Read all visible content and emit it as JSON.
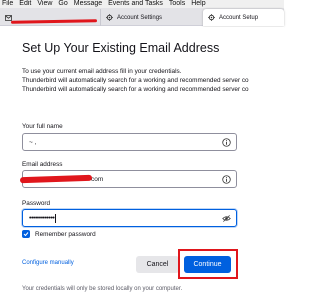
{
  "menubar": {
    "items": [
      "File",
      "Edit",
      "View",
      "Go",
      "Message",
      "Events and Tasks",
      "Tools",
      "Help"
    ]
  },
  "tabs": [
    {
      "label": "",
      "icon": "mail-icon"
    },
    {
      "label": "Account Settings",
      "icon": "gear-icon"
    },
    {
      "label": "Account Setup",
      "icon": "gear-icon"
    }
  ],
  "setup": {
    "title": "Set Up Your Existing Email Address",
    "intro_lines": [
      "To use your current email address fill in your credentials.",
      "Thunderbird will automatically search for a working and recommended server co",
      "Thunderbird will automatically search for a working and recommended server co"
    ],
    "name_label": "Your full name",
    "name_value": "~ ,",
    "email_label": "Email address",
    "email_value": "com",
    "password_label": "Password",
    "password_value": "•••••••••••••",
    "remember_label": "Remember password",
    "remember_checked": true,
    "configure_link": "Configure manually",
    "cancel_label": "Cancel",
    "continue_label": "Continue",
    "footer": "Your credentials will only be stored locally on your computer."
  },
  "colors": {
    "accent": "#0060df",
    "annotation": "#e0161c"
  }
}
